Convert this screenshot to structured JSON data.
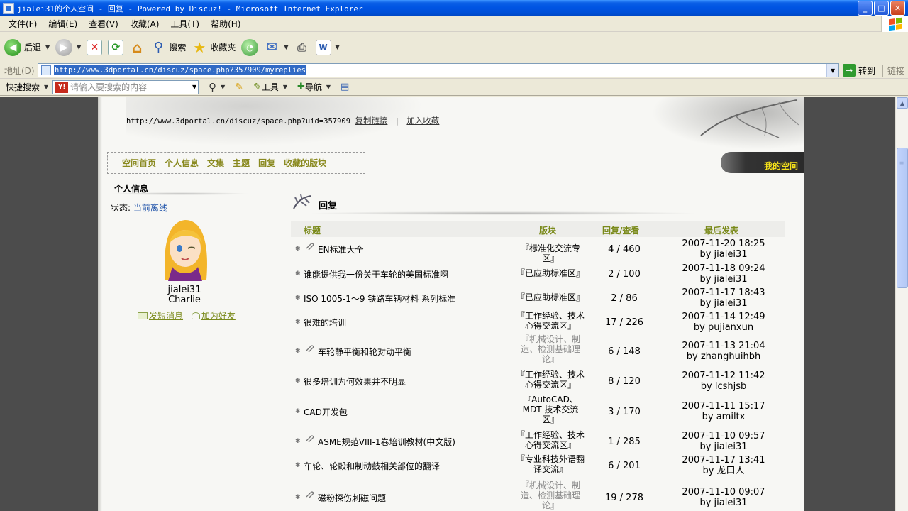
{
  "window": {
    "title": "jialei31的个人空间 - 回复 - Powered by Discuz! - Microsoft Internet Explorer"
  },
  "menu": [
    "文件(F)",
    "编辑(E)",
    "查看(V)",
    "收藏(A)",
    "工具(T)",
    "帮助(H)"
  ],
  "toolbar": {
    "back": "后退",
    "search": "搜索",
    "favorites": "收藏夹"
  },
  "address": {
    "label": "地址(D)",
    "url": "http://www.3dportal.cn/discuz/space.php?357909/myreplies",
    "go": "转到",
    "links": "链接"
  },
  "quicksearch": {
    "label": "快捷搜索",
    "placeholder": "请输入要搜索的内容",
    "tools": "工具",
    "nav": "导航"
  },
  "page": {
    "space_url": "http://www.3dportal.cn/discuz/space.php?uid=357909",
    "copy_link": "复制链接",
    "add_fav": "加入收藏",
    "nav": [
      "空间首页",
      "个人信息",
      "文集",
      "主题",
      "回复",
      "收藏的版块"
    ],
    "my_space": "我的空间",
    "profile": {
      "heading": "个人信息",
      "status_label": "状态:",
      "status_value": "当前离线",
      "username": "jialei31",
      "nickname": "Charlie",
      "send_msg": "发短消息",
      "add_friend": "加为好友"
    },
    "section_title": "回复",
    "columns": {
      "title": "标题",
      "forum": "版块",
      "stats": "回复/查看",
      "last": "最后发表"
    },
    "rows": [
      {
        "title": "EN标准大全",
        "attach": true,
        "forum": "『标准化交流专区』",
        "stats": "4 / 460",
        "date": "2007-11-20 18:25",
        "by": "by jialei31"
      },
      {
        "title": "谁能提供我一份关于车轮的美国标准啊",
        "attach": false,
        "forum": "『已应助标准区』",
        "stats": "2 / 100",
        "date": "2007-11-18 09:24",
        "by": "by jialei31"
      },
      {
        "title": "ISO 1005-1～9 铁路车辆材料  系列标准",
        "attach": false,
        "forum": "『已应助标准区』",
        "stats": "2 / 86",
        "date": "2007-11-17 18:43",
        "by": "by jialei31"
      },
      {
        "title": "很难的培训",
        "attach": false,
        "forum": "『工作经验、技术心得交流区』",
        "stats": "17 / 226",
        "date": "2007-11-14 12:49",
        "by": "by pujianxun"
      },
      {
        "title": "车轮静平衡和轮对动平衡",
        "attach": true,
        "forum": "『机械设计、制造、检测基础理论』",
        "stats": "6 / 148",
        "date": "2007-11-13 21:04",
        "by": "by zhanghuihbh"
      },
      {
        "title": "很多培训为何效果并不明显",
        "attach": false,
        "forum": "『工作经验、技术心得交流区』",
        "stats": "8 / 120",
        "date": "2007-11-12 11:42",
        "by": "by lcshjsb"
      },
      {
        "title": "CAD开发包",
        "attach": false,
        "forum": "『AutoCAD、MDT 技术交流区』",
        "stats": "3 / 170",
        "date": "2007-11-11 15:17",
        "by": "by amiltx"
      },
      {
        "title": "ASME规范VIII-1卷培训教材(中文版)",
        "attach": true,
        "forum": "『工作经验、技术心得交流区』",
        "stats": "1 / 285",
        "date": "2007-11-10 09:57",
        "by": "by jialei31"
      },
      {
        "title": "车轮、轮毂和制动鼓相关部位的翻译",
        "attach": false,
        "forum": "『专业科技外语翻译交流』",
        "stats": "6 / 201",
        "date": "2007-11-17 13:41",
        "by": "by 龙口人"
      },
      {
        "title": "磁粉探伤刺磁问题",
        "attach": true,
        "forum": "『机械设计、制造、检测基础理论』",
        "stats": "19 / 278",
        "date": "2007-11-10 09:07",
        "by": "by jialei31"
      }
    ]
  }
}
